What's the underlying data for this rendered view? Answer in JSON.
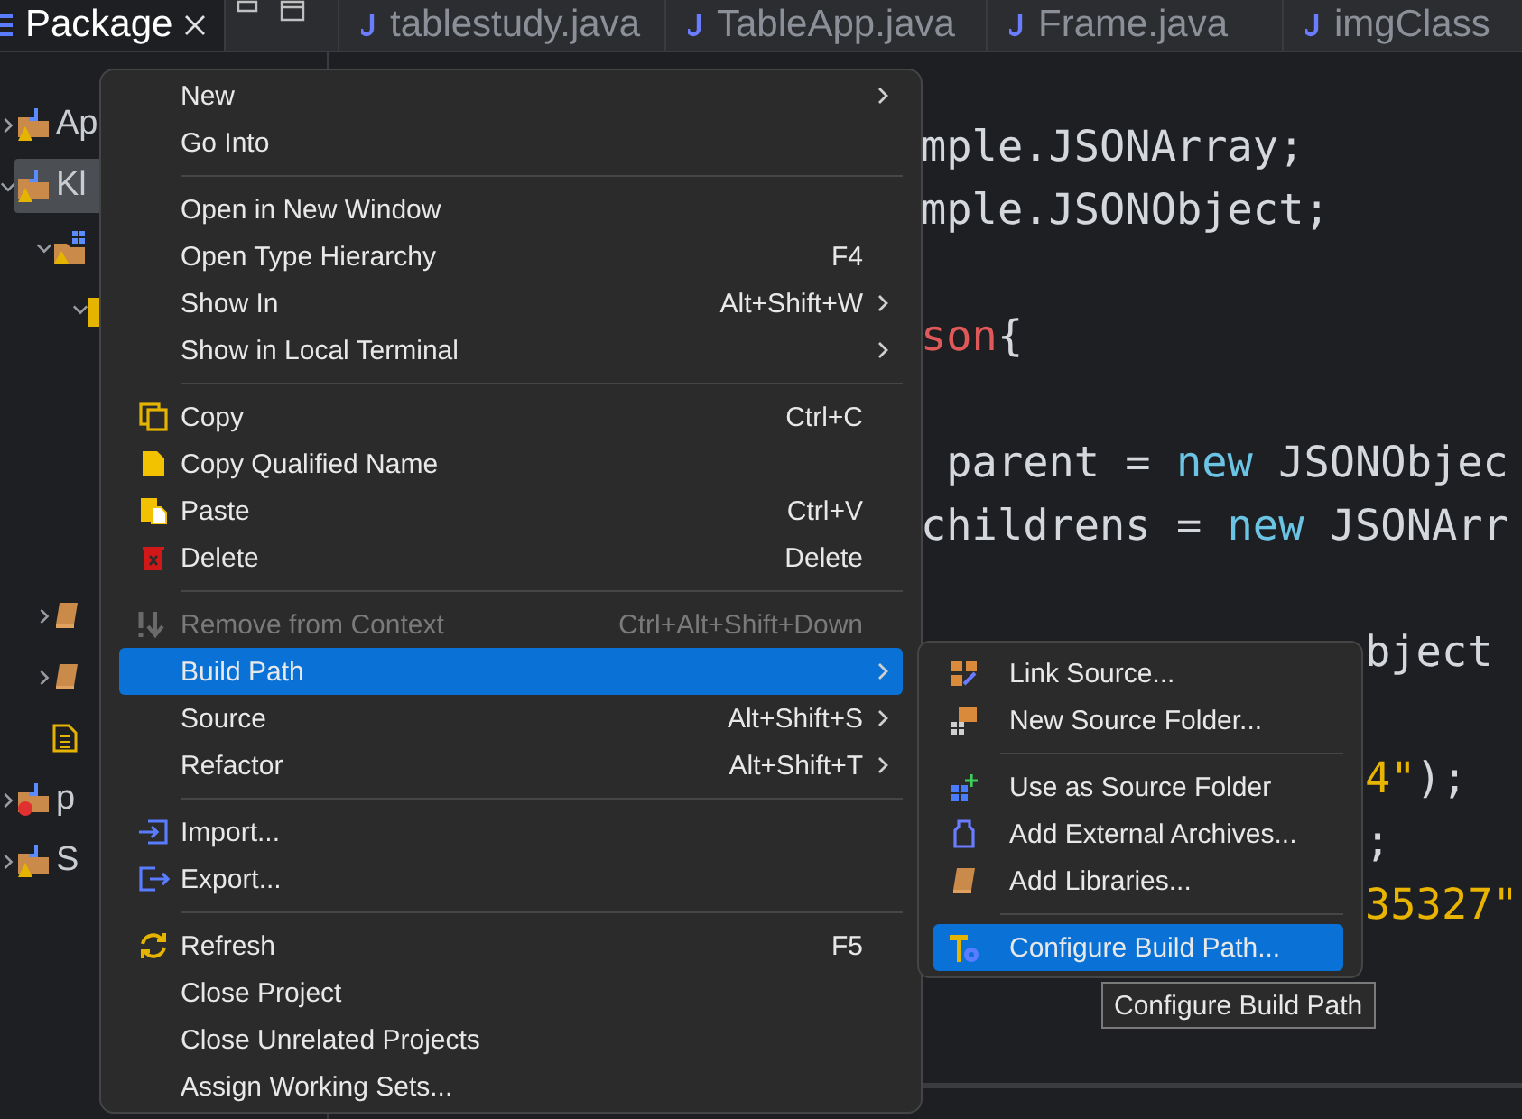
{
  "tabs": [
    {
      "label": "Package",
      "selected": true,
      "closable": true
    },
    {
      "label": "tablestudy.java",
      "selected": false,
      "closable": false
    },
    {
      "label": "TableApp.java",
      "selected": false,
      "closable": false
    },
    {
      "label": "Frame.java",
      "selected": false,
      "closable": false
    },
    {
      "label": "imgClass",
      "selected": false,
      "closable": false
    }
  ],
  "tree": [
    {
      "label": "Ap",
      "kind": "project",
      "warning": true,
      "error": false,
      "expanded": false,
      "selected": false
    },
    {
      "label": "Kl",
      "kind": "project",
      "warning": true,
      "error": false,
      "expanded": true,
      "selected": true,
      "children": [
        {
          "kind": "source-folder",
          "expanded": true,
          "selected": false,
          "children": [
            {
              "kind": "package",
              "expanded": true,
              "selected": false
            }
          ]
        },
        {
          "kind": "library",
          "expanded": false,
          "selected": false
        },
        {
          "kind": "library",
          "expanded": false,
          "selected": false
        },
        {
          "kind": "file",
          "selected": false
        }
      ]
    },
    {
      "label": "p",
      "kind": "project",
      "warning": false,
      "error": true,
      "expanded": false,
      "selected": false
    },
    {
      "label": "S",
      "kind": "project",
      "warning": true,
      "error": false,
      "expanded": false,
      "selected": false
    }
  ],
  "code_lines": [
    {
      "kind": "blank"
    },
    {
      "kind": "code",
      "tokens": [
        {
          "text": "mple.JSONArray;",
          "kind": "plain"
        }
      ]
    },
    {
      "kind": "code",
      "tokens": [
        {
          "text": "mple.JSONObject;",
          "kind": "plain"
        }
      ]
    },
    {
      "kind": "blank"
    },
    {
      "kind": "code",
      "tokens": [
        {
          "text": "son",
          "kind": "type"
        },
        {
          "text": "{",
          "kind": "plain"
        }
      ]
    },
    {
      "kind": "blank"
    },
    {
      "kind": "code",
      "tokens": [
        {
          "text": " parent = ",
          "kind": "plain"
        },
        {
          "text": "new",
          "kind": "keyword"
        },
        {
          "text": " JSONObjec",
          "kind": "plain"
        }
      ]
    },
    {
      "kind": "code",
      "tokens": [
        {
          "text": "childrens = ",
          "kind": "plain"
        },
        {
          "text": "new",
          "kind": "keyword"
        },
        {
          "text": " JSONArr",
          "kind": "plain"
        }
      ]
    },
    {
      "kind": "blank"
    },
    {
      "kind": "tail",
      "tokens": [
        {
          "text": "bject",
          "kind": "plain"
        }
      ]
    },
    {
      "kind": "blank"
    },
    {
      "kind": "tail",
      "tokens": [
        {
          "text": "4\"",
          "kind": "string"
        },
        {
          "text": ");",
          "kind": "plain"
        }
      ]
    },
    {
      "kind": "tail",
      "tokens": [
        {
          "text": ";",
          "kind": "plain"
        }
      ]
    },
    {
      "kind": "tail",
      "tokens": [
        {
          "text": "35327\"",
          "kind": "string"
        }
      ]
    }
  ],
  "context_menu": [
    {
      "kind": "item",
      "label": "New",
      "submenu": true,
      "disabled": false,
      "selected": false
    },
    {
      "kind": "item",
      "label": "Go Into",
      "submenu": false,
      "disabled": false,
      "selected": false
    },
    {
      "kind": "separator"
    },
    {
      "kind": "item",
      "label": "Open in New Window",
      "submenu": false,
      "disabled": false,
      "selected": false
    },
    {
      "kind": "item",
      "label": "Open Type Hierarchy",
      "shortcut": "F4",
      "submenu": false,
      "disabled": false,
      "selected": false
    },
    {
      "kind": "item",
      "label": "Show In",
      "shortcut": "Alt+Shift+W",
      "submenu": true,
      "disabled": false,
      "selected": false
    },
    {
      "kind": "item",
      "label": "Show in Local Terminal",
      "submenu": true,
      "disabled": false,
      "selected": false
    },
    {
      "kind": "separator"
    },
    {
      "kind": "item",
      "label": "Copy",
      "shortcut": "Ctrl+C",
      "submenu": false,
      "disabled": false,
      "selected": false
    },
    {
      "kind": "item",
      "label": "Copy Qualified Name",
      "submenu": false,
      "disabled": false,
      "selected": false
    },
    {
      "kind": "item",
      "label": "Paste",
      "shortcut": "Ctrl+V",
      "submenu": false,
      "disabled": false,
      "selected": false
    },
    {
      "kind": "item",
      "label": "Delete",
      "shortcut": "Delete",
      "submenu": false,
      "disabled": false,
      "selected": false
    },
    {
      "kind": "separator"
    },
    {
      "kind": "item",
      "label": "Remove from Context",
      "shortcut": "Ctrl+Alt+Shift+Down",
      "submenu": false,
      "disabled": true,
      "selected": false
    },
    {
      "kind": "item",
      "label": "Build Path",
      "submenu": true,
      "disabled": false,
      "selected": true
    },
    {
      "kind": "item",
      "label": "Source",
      "shortcut": "Alt+Shift+S",
      "submenu": true,
      "disabled": false,
      "selected": false
    },
    {
      "kind": "item",
      "label": "Refactor",
      "shortcut": "Alt+Shift+T",
      "submenu": true,
      "disabled": false,
      "selected": false
    },
    {
      "kind": "separator"
    },
    {
      "kind": "item",
      "label": "Import...",
      "submenu": false,
      "disabled": false,
      "selected": false
    },
    {
      "kind": "item",
      "label": "Export...",
      "submenu": false,
      "disabled": false,
      "selected": false
    },
    {
      "kind": "separator"
    },
    {
      "kind": "item",
      "label": "Refresh",
      "shortcut": "F5",
      "submenu": false,
      "disabled": false,
      "selected": false
    },
    {
      "kind": "item",
      "label": "Close Project",
      "submenu": false,
      "disabled": false,
      "selected": false
    },
    {
      "kind": "item",
      "label": "Close Unrelated Projects",
      "submenu": false,
      "disabled": false,
      "selected": false
    },
    {
      "kind": "item",
      "label": "Assign Working Sets...",
      "submenu": false,
      "disabled": false,
      "selected": false
    }
  ],
  "submenu": [
    {
      "kind": "item",
      "label": "Link Source...",
      "selected": false
    },
    {
      "kind": "item",
      "label": "New Source Folder...",
      "selected": false
    },
    {
      "kind": "separator"
    },
    {
      "kind": "item",
      "label": "Use as Source Folder",
      "selected": false
    },
    {
      "kind": "item",
      "label": "Add External Archives...",
      "selected": false
    },
    {
      "kind": "item",
      "label": "Add Libraries...",
      "selected": false
    },
    {
      "kind": "separator"
    },
    {
      "kind": "item",
      "label": "Configure Build Path...",
      "selected": true
    }
  ],
  "tooltip": "Configure Build Path"
}
